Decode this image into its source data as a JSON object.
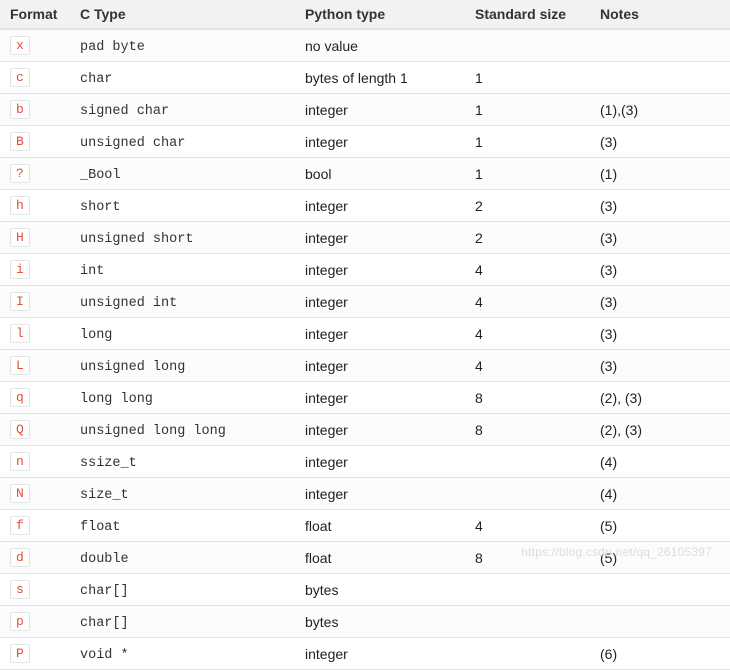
{
  "headers": {
    "format": "Format",
    "ctype": "C Type",
    "ptype": "Python type",
    "size": "Standard size",
    "notes": "Notes"
  },
  "rows": [
    {
      "fmt": "x",
      "ctype": "pad byte",
      "ptype": "no value",
      "size": "",
      "notes": ""
    },
    {
      "fmt": "c",
      "ctype": "char",
      "ptype": "bytes of length 1",
      "size": "1",
      "notes": ""
    },
    {
      "fmt": "b",
      "ctype": "signed char",
      "ptype": "integer",
      "size": "1",
      "notes": "(1),(3)"
    },
    {
      "fmt": "B",
      "ctype": "unsigned char",
      "ptype": "integer",
      "size": "1",
      "notes": "(3)"
    },
    {
      "fmt": "?",
      "ctype": "_Bool",
      "ptype": "bool",
      "size": "1",
      "notes": "(1)"
    },
    {
      "fmt": "h",
      "ctype": "short",
      "ptype": "integer",
      "size": "2",
      "notes": "(3)"
    },
    {
      "fmt": "H",
      "ctype": "unsigned short",
      "ptype": "integer",
      "size": "2",
      "notes": "(3)"
    },
    {
      "fmt": "i",
      "ctype": "int",
      "ptype": "integer",
      "size": "4",
      "notes": "(3)"
    },
    {
      "fmt": "I",
      "ctype": "unsigned int",
      "ptype": "integer",
      "size": "4",
      "notes": "(3)"
    },
    {
      "fmt": "l",
      "ctype": "long",
      "ptype": "integer",
      "size": "4",
      "notes": "(3)"
    },
    {
      "fmt": "L",
      "ctype": "unsigned long",
      "ptype": "integer",
      "size": "4",
      "notes": "(3)"
    },
    {
      "fmt": "q",
      "ctype": "long long",
      "ptype": "integer",
      "size": "8",
      "notes": "(2), (3)"
    },
    {
      "fmt": "Q",
      "ctype": "unsigned long long",
      "ptype": "integer",
      "size": "8",
      "notes": "(2), (3)"
    },
    {
      "fmt": "n",
      "ctype": "ssize_t",
      "ptype": "integer",
      "size": "",
      "notes": "(4)"
    },
    {
      "fmt": "N",
      "ctype": "size_t",
      "ptype": "integer",
      "size": "",
      "notes": "(4)"
    },
    {
      "fmt": "f",
      "ctype": "float",
      "ptype": "float",
      "size": "4",
      "notes": "(5)"
    },
    {
      "fmt": "d",
      "ctype": "double",
      "ptype": "float",
      "size": "8",
      "notes": "(5)"
    },
    {
      "fmt": "s",
      "ctype": "char[]",
      "ptype": "bytes",
      "size": "",
      "notes": ""
    },
    {
      "fmt": "p",
      "ctype": "char[]",
      "ptype": "bytes",
      "size": "",
      "notes": ""
    },
    {
      "fmt": "P",
      "ctype": "void *",
      "ptype": "integer",
      "size": "",
      "notes": "(6)"
    }
  ],
  "watermark": "https://blog.csdn.net/qq_26105397"
}
